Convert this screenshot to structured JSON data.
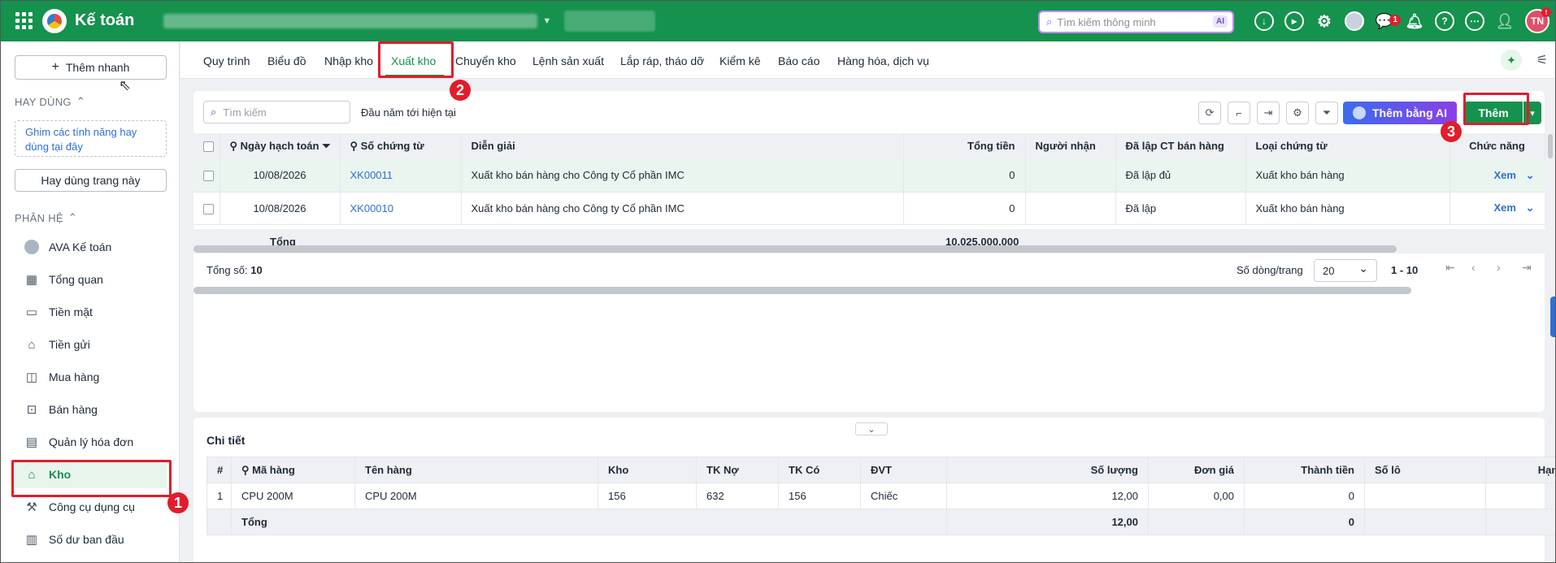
{
  "app": {
    "title": "Kế toán"
  },
  "topbar": {
    "search_placeholder": "Tìm kiếm thông minh",
    "search_ai": "AI",
    "notif_count": "1",
    "user_initials": "TN"
  },
  "sidebar": {
    "quick_add": "Thêm nhanh",
    "frequent_title": "HAY DÙNG",
    "pin_hint": "Ghim các tính năng hay dùng tại đây",
    "use_this_page": "Hay dùng trang này",
    "modules_title": "PHÂN HỆ",
    "items": [
      {
        "label": "AVA Kế toán",
        "icon": "ava-avatar-icon"
      },
      {
        "label": "Tổng quan",
        "icon": "dashboard-icon"
      },
      {
        "label": "Tiền mặt",
        "icon": "cash-icon"
      },
      {
        "label": "Tiền gửi",
        "icon": "bank-icon"
      },
      {
        "label": "Mua hàng",
        "icon": "shopping-bag-icon"
      },
      {
        "label": "Bán hàng",
        "icon": "cart-icon"
      },
      {
        "label": "Quản lý hóa đơn",
        "icon": "invoice-icon"
      },
      {
        "label": "Kho",
        "icon": "warehouse-icon"
      },
      {
        "label": "Công cụ dụng cụ",
        "icon": "tools-icon"
      },
      {
        "label": "Số dư ban đầu",
        "icon": "opening-balance-icon"
      }
    ]
  },
  "tabs": [
    "Quy trình",
    "Biểu đồ",
    "Nhập kho",
    "Xuất kho",
    "Chuyển kho",
    "Lệnh sản xuất",
    "Lắp ráp, tháo dỡ",
    "Kiểm kê",
    "Báo cáo",
    "Hàng hóa, dịch vụ"
  ],
  "toolbar": {
    "search_placeholder": "Tìm kiếm",
    "period": "Đầu năm tới hiện tại",
    "ai_add": "Thêm bằng AI",
    "add": "Thêm"
  },
  "grid": {
    "columns": [
      "Ngày hạch toán",
      "Số chứng từ",
      "Diễn giải",
      "Tổng tiền",
      "Người nhận",
      "Đã lập CT bán hàng",
      "Loại chứng từ",
      "Chức năng"
    ],
    "rows": [
      {
        "date": "10/08/2026",
        "doc": "XK00011",
        "desc": "Xuất kho bán hàng cho Công ty Cổ phần IMC",
        "total": "0",
        "receiver": "",
        "sales_doc": "Đã lập đủ",
        "type": "Xuất kho bán hàng",
        "action": "Xem"
      },
      {
        "date": "10/08/2026",
        "doc": "XK00010",
        "desc": "Xuất kho bán hàng cho Công ty Cổ phần IMC",
        "total": "0",
        "receiver": "",
        "sales_doc": "Đã lập",
        "type": "Xuất kho bán hàng",
        "action": "Xem"
      }
    ],
    "total_label": "Tổng",
    "total_value": "10.025.000.000"
  },
  "footer": {
    "count_label": "Tổng số:",
    "count": "10",
    "rows_per_page_label": "Số dòng/trang",
    "rows_per_page": "20",
    "range": "1 - 10"
  },
  "detail": {
    "title": "Chi tiết",
    "columns": [
      "#",
      "Mã hàng",
      "Tên hàng",
      "Kho",
      "TK Nợ",
      "TK Có",
      "ĐVT",
      "Số lượng",
      "Đơn giá",
      "Thành tiền",
      "Số lô",
      "Hạn sử dụng"
    ],
    "rows": [
      {
        "no": "1",
        "code": "CPU 200M",
        "name": "CPU 200M",
        "warehouse": "156",
        "debit": "632",
        "credit": "156",
        "unit": "Chiếc",
        "qty": "12,00",
        "price": "0,00",
        "amount": "0",
        "lot": "",
        "expiry": ""
      }
    ],
    "total_label": "Tổng",
    "total_qty": "12,00",
    "total_amount": "0"
  },
  "annotations": [
    "1",
    "2",
    "3"
  ],
  "colors": {
    "brand": "#15924d",
    "annotation": "#e11d2a",
    "link": "#2f6fd8"
  }
}
